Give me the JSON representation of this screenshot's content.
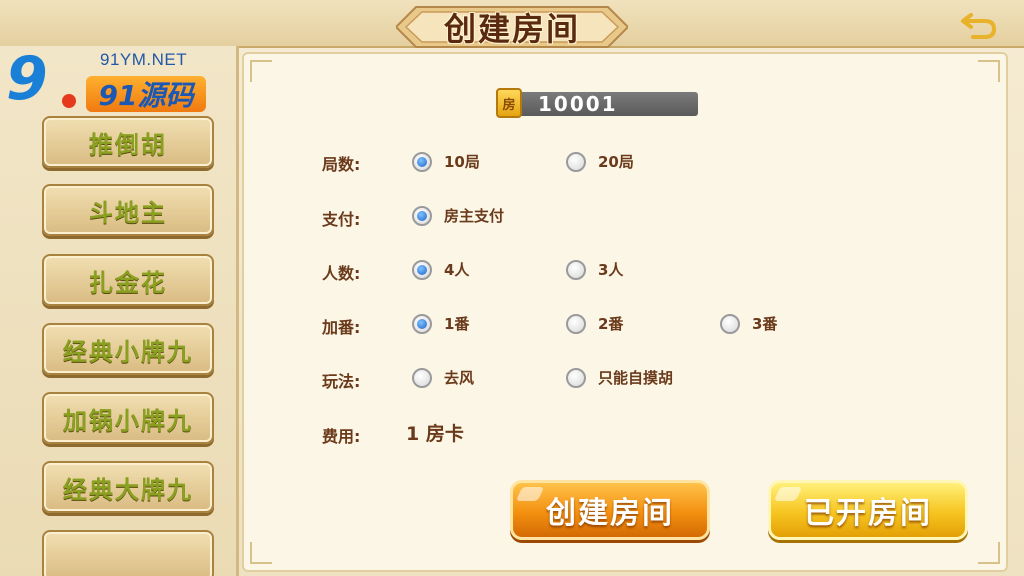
{
  "header": {
    "title": "创建房间",
    "back_icon": "back-arrow-icon"
  },
  "logo": {
    "numerals": "9",
    "url": "91YM.NET",
    "badge": "91源码"
  },
  "sidebar": {
    "items": [
      {
        "label": "推倒胡"
      },
      {
        "label": "斗地主"
      },
      {
        "label": "扎金花"
      },
      {
        "label": "经典小牌九"
      },
      {
        "label": "加锅小牌九"
      },
      {
        "label": "经典大牌九"
      },
      {
        "label": ""
      }
    ]
  },
  "room": {
    "icon_label": "房",
    "number": "10001"
  },
  "options": {
    "rounds": {
      "label": "局数:",
      "choices": [
        {
          "text": "10局",
          "selected": true
        },
        {
          "text": "20局",
          "selected": false
        }
      ]
    },
    "payment": {
      "label": "支付:",
      "choices": [
        {
          "text": "房主支付",
          "selected": true
        }
      ]
    },
    "players": {
      "label": "人数:",
      "choices": [
        {
          "text": "4人",
          "selected": true
        },
        {
          "text": "3人",
          "selected": false
        }
      ]
    },
    "multiplier": {
      "label": "加番:",
      "choices": [
        {
          "text": "1番",
          "selected": true
        },
        {
          "text": "2番",
          "selected": false
        },
        {
          "text": "3番",
          "selected": false
        }
      ]
    },
    "rules": {
      "label": "玩法:",
      "choices": [
        {
          "text": "去风",
          "selected": false
        },
        {
          "text": "只能自摸胡",
          "selected": false
        }
      ]
    },
    "fee": {
      "label": "费用:",
      "value": "1 房卡"
    }
  },
  "buttons": {
    "create": "创建房间",
    "opened": "已开房间"
  },
  "colors": {
    "text_brown": "#6b3a1b",
    "radio_selected": "#1b62c8",
    "create_orange": "#f39010",
    "opened_yellow": "#f6c520",
    "sidebar_text_green": "#8aa020"
  }
}
